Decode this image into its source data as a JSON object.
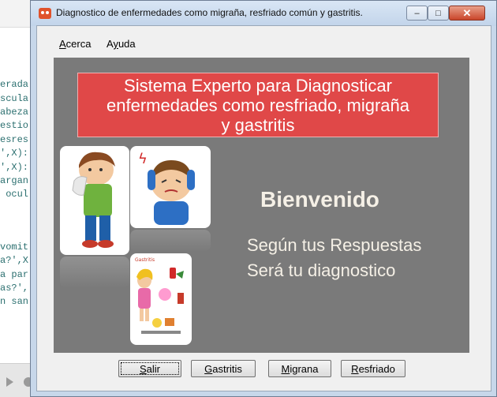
{
  "background_editor": {
    "lines": [
      "erada",
      "scula",
      "abeza",
      "estio",
      "esres",
      "',X):",
      "',X):",
      "argan",
      " ocul",
      "vomit",
      "a?',X",
      "a par",
      "as?',",
      "n san"
    ]
  },
  "window": {
    "title": "Diagnostico de enfermedades como migraña, resfriado común y gastritis.",
    "controls": {
      "minimize": "–",
      "maximize": "□",
      "close": "✕"
    }
  },
  "menu": {
    "acerca": {
      "mnemonic": "A",
      "rest": "cerca"
    },
    "ayuda": {
      "mnemonic": "y",
      "pre": "A",
      "rest": "uda"
    }
  },
  "banner": {
    "line1": "Sistema Experto para Diagnosticar",
    "line2": "enfermedades como resfriado, migraña",
    "line3": "y gastritis"
  },
  "welcome": "Bienvenido",
  "subtitle_line1": "Según tus Respuestas",
  "subtitle_line2": "Será tu diagnostico",
  "images": {
    "flu": "sneezing-child-illustration",
    "headache": "child-headache-illustration",
    "gastritis": "gastritis-foods-illustration",
    "headache_symbol": "ϟ",
    "gastritis_caption": "Gastritis"
  },
  "buttons": {
    "salir": {
      "mnemonic": "S",
      "rest": "alir"
    },
    "gastritis": {
      "mnemonic": "G",
      "rest": "astritis"
    },
    "migrana": {
      "mnemonic": "M",
      "rest": "igrana"
    },
    "resfriado": {
      "mnemonic": "R",
      "rest": "esfriado"
    }
  },
  "colors": {
    "banner": "#e04848",
    "panel": "#7a7a7a",
    "title_bar": "#c7d7ea"
  }
}
